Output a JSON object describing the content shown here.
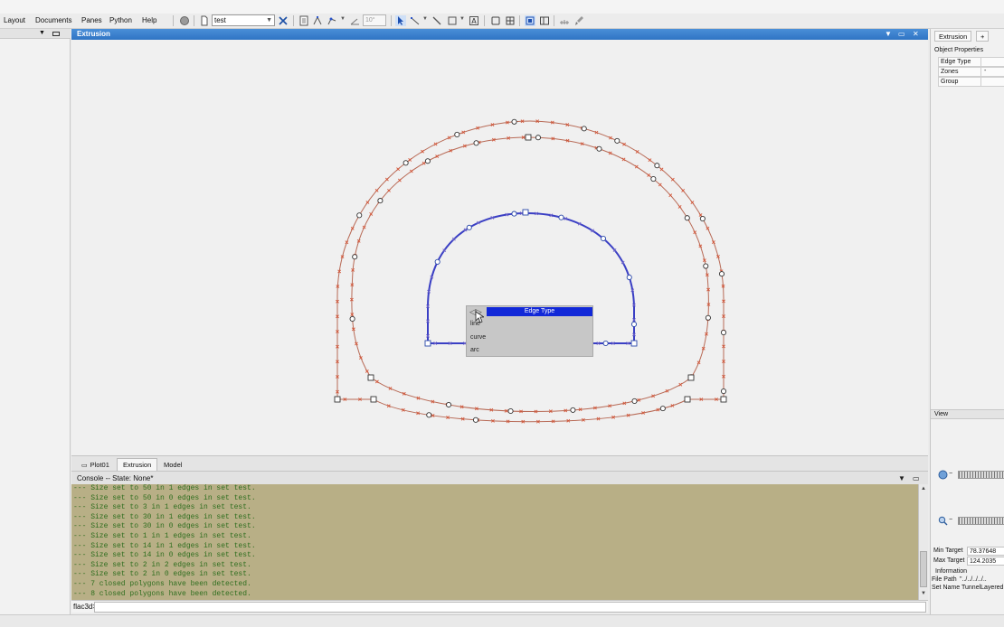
{
  "menubar": {
    "items": [
      "Layout",
      "Documents",
      "Panes",
      "Python",
      "Help"
    ],
    "document_select": "test",
    "angle_value": "10°"
  },
  "window": {
    "title": "Extrusion"
  },
  "tabs": [
    "Plot01",
    "Extrusion",
    "Model"
  ],
  "active_tab": "Extrusion",
  "console": {
    "header": "Console -- State: None*",
    "lines": [
      "--- Size set to 50 in 1 edges in set test.",
      "--- Size set to 50 in 0 edges in set test.",
      "--- Size set to 3 in 1 edges in set test.",
      "--- Size set to 30 in 1 edges in set test.",
      "--- Size set to 30 in 0 edges in set test.",
      "--- Size set to 1 in 1 edges in set test.",
      "--- Size set to 14 in 1 edges in set test.",
      "--- Size set to 14 in 0 edges in set test.",
      "--- Size set to 2 in 2 edges in set test.",
      "--- Size set to 2 in 0 edges in set test.",
      "--- 7 closed polygons have been detected.",
      "--- 8 closed polygons have been detected."
    ],
    "prompt": "flac3d>"
  },
  "popup": {
    "title": "Edge Type",
    "options": [
      "line",
      "curve",
      "arc"
    ]
  },
  "right_panel": {
    "tab": "Extrusion",
    "tab_add": "+",
    "section_title": "Object Properties",
    "properties": [
      {
        "label": "Edge Type",
        "value": ""
      },
      {
        "label": "Zones",
        "value": "-"
      },
      {
        "label": "Group",
        "value": ""
      }
    ],
    "view_title": "View",
    "min_target_label": "Min Target",
    "min_target_value": "78.37648",
    "max_target_label": "Max Target",
    "max_target_value": "124.2035",
    "information_label": "Information",
    "file_path_label": "File Path",
    "file_path_value": "\"../../../../..",
    "set_name_label": "Set Name",
    "set_name_value": "TunnelLayered"
  },
  "colors": {
    "title_bar": "#2f74c4",
    "popup_header": "#1128d8",
    "console_bg": "#b8af86",
    "console_text": "#2f6e1f",
    "outer_edges": "#b86a56",
    "edge_marks": "#d2573a",
    "inner_edge": "#3a3fc4"
  }
}
